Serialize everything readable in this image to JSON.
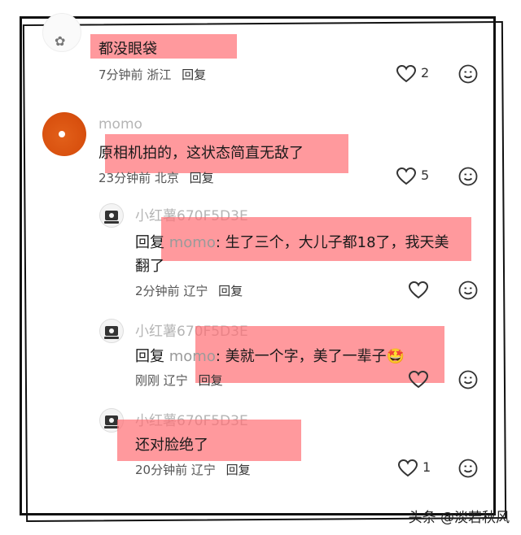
{
  "comments": [
    {
      "text": "都没眼袋",
      "time": "7分钟前",
      "location": "浙江",
      "reply_label": "回复",
      "likes": "2"
    },
    {
      "username": "momo",
      "text": "原相机拍的，这状态简直无敌了",
      "time": "23分钟前",
      "location": "北京",
      "reply_label": "回复",
      "likes": "5"
    }
  ],
  "replies": [
    {
      "username": "小红薯670F5D3E",
      "prefix": "回复",
      "target": "momo",
      "text_line1": ": 生了三个，大儿子都18了，我天美",
      "text_line2": "翻了",
      "time": "2分钟前",
      "location": "辽宁",
      "reply_label": "回复"
    },
    {
      "username": "小红薯670F5D3E",
      "prefix": "回复",
      "target": "momo",
      "text_line1": ": 美就一个字，美了一辈子🤩",
      "time": "刚刚",
      "location": "辽宁",
      "reply_label": "回复"
    },
    {
      "username": "小红薯670F5D3E",
      "text": "还对脸绝了",
      "time": "20分钟前",
      "location": "辽宁",
      "reply_label": "回复",
      "likes": "1"
    }
  ],
  "watermark": "头条 @淡若秋风",
  "colors": {
    "highlight": "#ff6e73",
    "avatar_orange": "#d9510f",
    "name_gray": "#b5b5b5"
  },
  "icons": [
    "heart-icon",
    "emoji-face-icon",
    "camera-avatar-icon"
  ]
}
